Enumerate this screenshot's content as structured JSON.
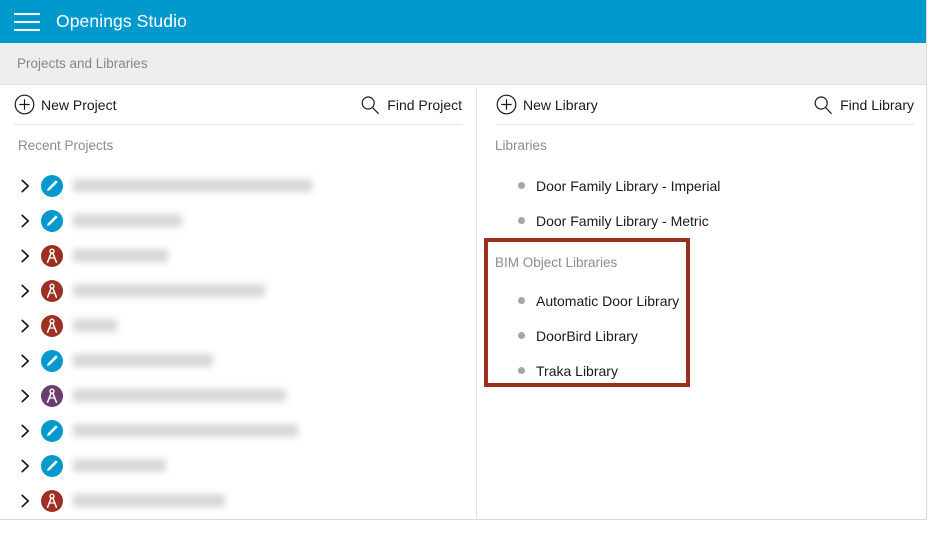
{
  "window": {
    "header": {
      "title": "Openings Studio",
      "menu_icon": "hamburger-icon",
      "background_color": "#0099ce"
    },
    "breadcrumb": {
      "text": "Projects and Libraries"
    }
  },
  "projects_panel": {
    "toolbar": {
      "new_label": "New Project",
      "new_icon": "plus-circle-icon",
      "find_label": "Find Project",
      "find_icon": "search-icon"
    },
    "section_label": "Recent Projects",
    "rows": [
      {
        "icon": "pencil-circle-icon",
        "icon_color": "#0099ce",
        "name": "",
        "redacted_width": 239
      },
      {
        "icon": "pencil-circle-icon",
        "icon_color": "#0099ce",
        "name": "",
        "redacted_width": 109
      },
      {
        "icon": "compass-circle-icon",
        "icon_color": "#9e3023",
        "name": "",
        "redacted_width": 95
      },
      {
        "icon": "compass-circle-icon",
        "icon_color": "#9e3023",
        "name": "",
        "redacted_width": 192
      },
      {
        "icon": "compass-circle-icon",
        "icon_color": "#9e3023",
        "name": "",
        "redacted_width": 44
      },
      {
        "icon": "pencil-circle-icon",
        "icon_color": "#0099ce",
        "name": "",
        "redacted_width": 140
      },
      {
        "icon": "compass-circle-icon",
        "icon_color": "#6b3f6b",
        "name": "",
        "redacted_width": 213
      },
      {
        "icon": "pencil-circle-icon",
        "icon_color": "#0099ce",
        "name": "",
        "redacted_width": 225
      },
      {
        "icon": "pencil-circle-icon",
        "icon_color": "#0099ce",
        "name": "",
        "redacted_width": 93
      },
      {
        "icon": "compass-circle-icon",
        "icon_color": "#9e3023",
        "name": "",
        "redacted_width": 152
      }
    ]
  },
  "libraries_panel": {
    "toolbar": {
      "new_label": "New Library",
      "new_icon": "plus-circle-icon",
      "find_label": "Find Library",
      "find_icon": "search-icon"
    },
    "section_label": "Libraries",
    "items": [
      {
        "name": "Door Family Library - Imperial"
      },
      {
        "name": "Door Family Library - Metric"
      }
    ],
    "bim_section": {
      "section_label": "BIM Object Libraries",
      "highlight_color": "#9a2f20",
      "items": [
        {
          "name": "Automatic Door Library"
        },
        {
          "name": "DoorBird Library"
        },
        {
          "name": "Traka Library"
        }
      ]
    }
  }
}
